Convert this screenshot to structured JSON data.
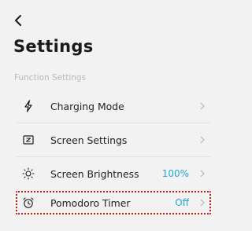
{
  "header": {
    "back_icon": "chevron-left-icon",
    "title": "Settings"
  },
  "section": {
    "label": "Function Settings"
  },
  "items": [
    {
      "label": "Charging Mode",
      "icon": "lightning-icon",
      "value": ""
    },
    {
      "label": "Screen Settings",
      "icon": "screen-icon",
      "value": ""
    },
    {
      "label": "Screen Brightness",
      "icon": "sun-icon",
      "value": "100%"
    },
    {
      "label": "Pomodoro Timer",
      "icon": "alarm-clock-icon",
      "value": "Off"
    }
  ],
  "colors": {
    "accent": "#25a7d4",
    "highlight": "#d11b1b",
    "background": "#f2f2f2"
  }
}
